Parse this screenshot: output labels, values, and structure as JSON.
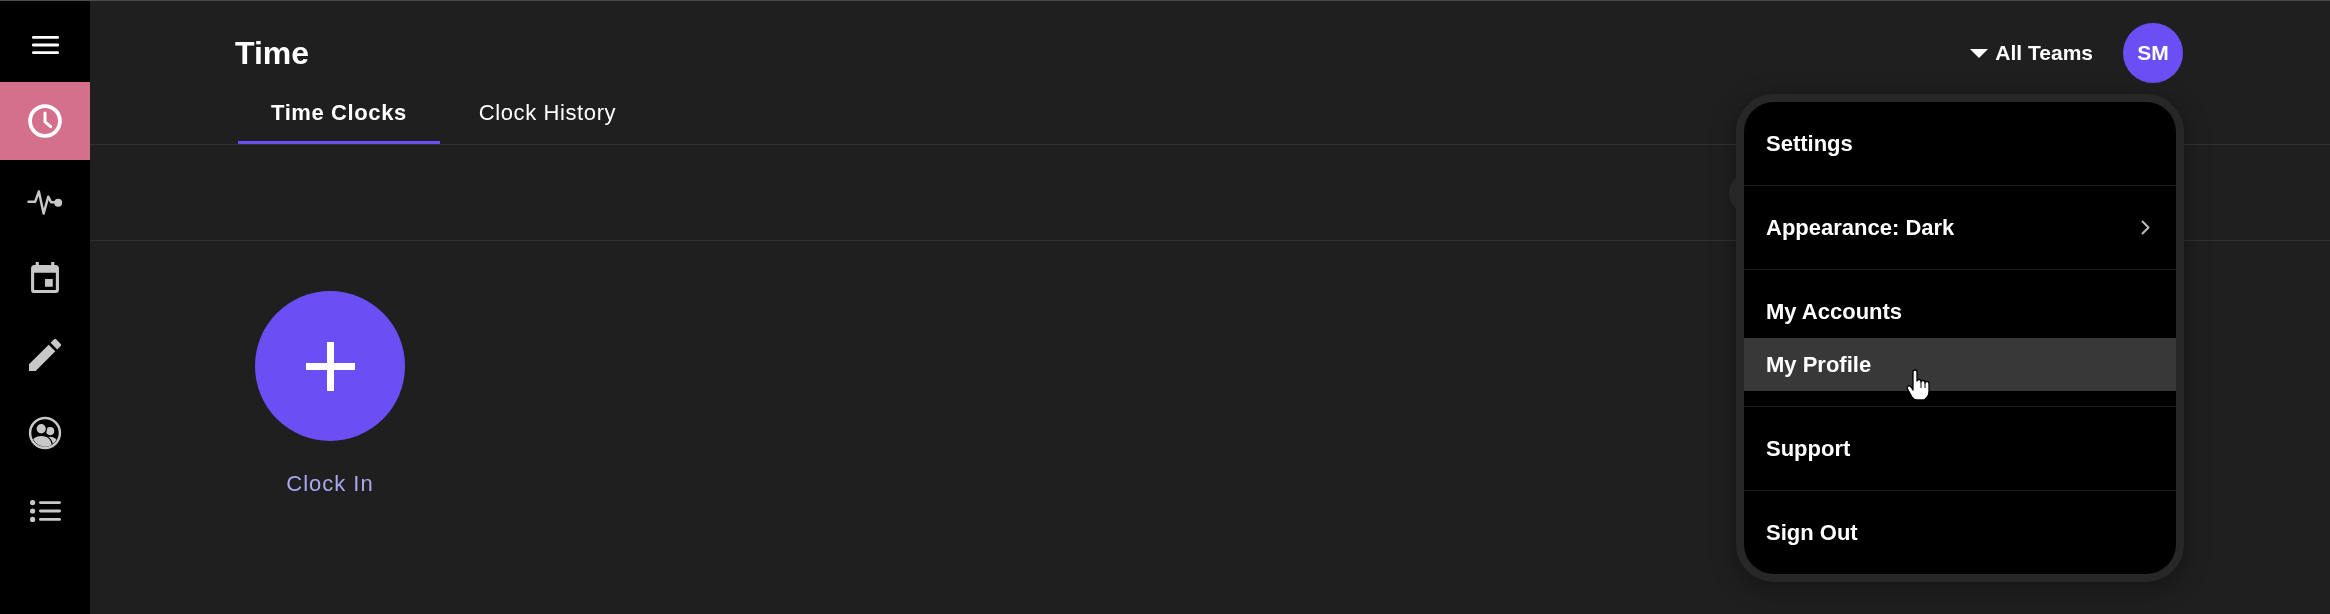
{
  "sidebar": {
    "items": [
      {
        "kind": "clock",
        "selected": true
      },
      {
        "kind": "activity",
        "selected": false
      },
      {
        "kind": "calendar",
        "selected": false
      },
      {
        "kind": "edit",
        "selected": false
      },
      {
        "kind": "people",
        "selected": false
      },
      {
        "kind": "list",
        "selected": false
      }
    ]
  },
  "header": {
    "title": "Time",
    "tabs": [
      {
        "label": "Time Clocks",
        "selected": true
      },
      {
        "label": "Clock History",
        "selected": false
      }
    ],
    "team_filter": {
      "label": "All Teams"
    },
    "avatar": {
      "initials": "SM"
    }
  },
  "clock_in": {
    "label": "Clock In"
  },
  "account_menu": {
    "sections": [
      {
        "items": [
          {
            "label": "Settings",
            "kind": "action",
            "highlighted": false
          }
        ]
      },
      {
        "items": [
          {
            "label": "Appearance: Dark",
            "kind": "submenu",
            "highlighted": false
          }
        ]
      },
      {
        "items": [
          {
            "label": "My Accounts",
            "kind": "action",
            "highlighted": false
          },
          {
            "label": "My Profile",
            "kind": "action",
            "highlighted": true
          }
        ]
      },
      {
        "items": [
          {
            "label": "Support",
            "kind": "action",
            "highlighted": false
          }
        ]
      },
      {
        "items": [
          {
            "label": "Sign Out",
            "kind": "action",
            "highlighted": false
          }
        ]
      }
    ]
  }
}
